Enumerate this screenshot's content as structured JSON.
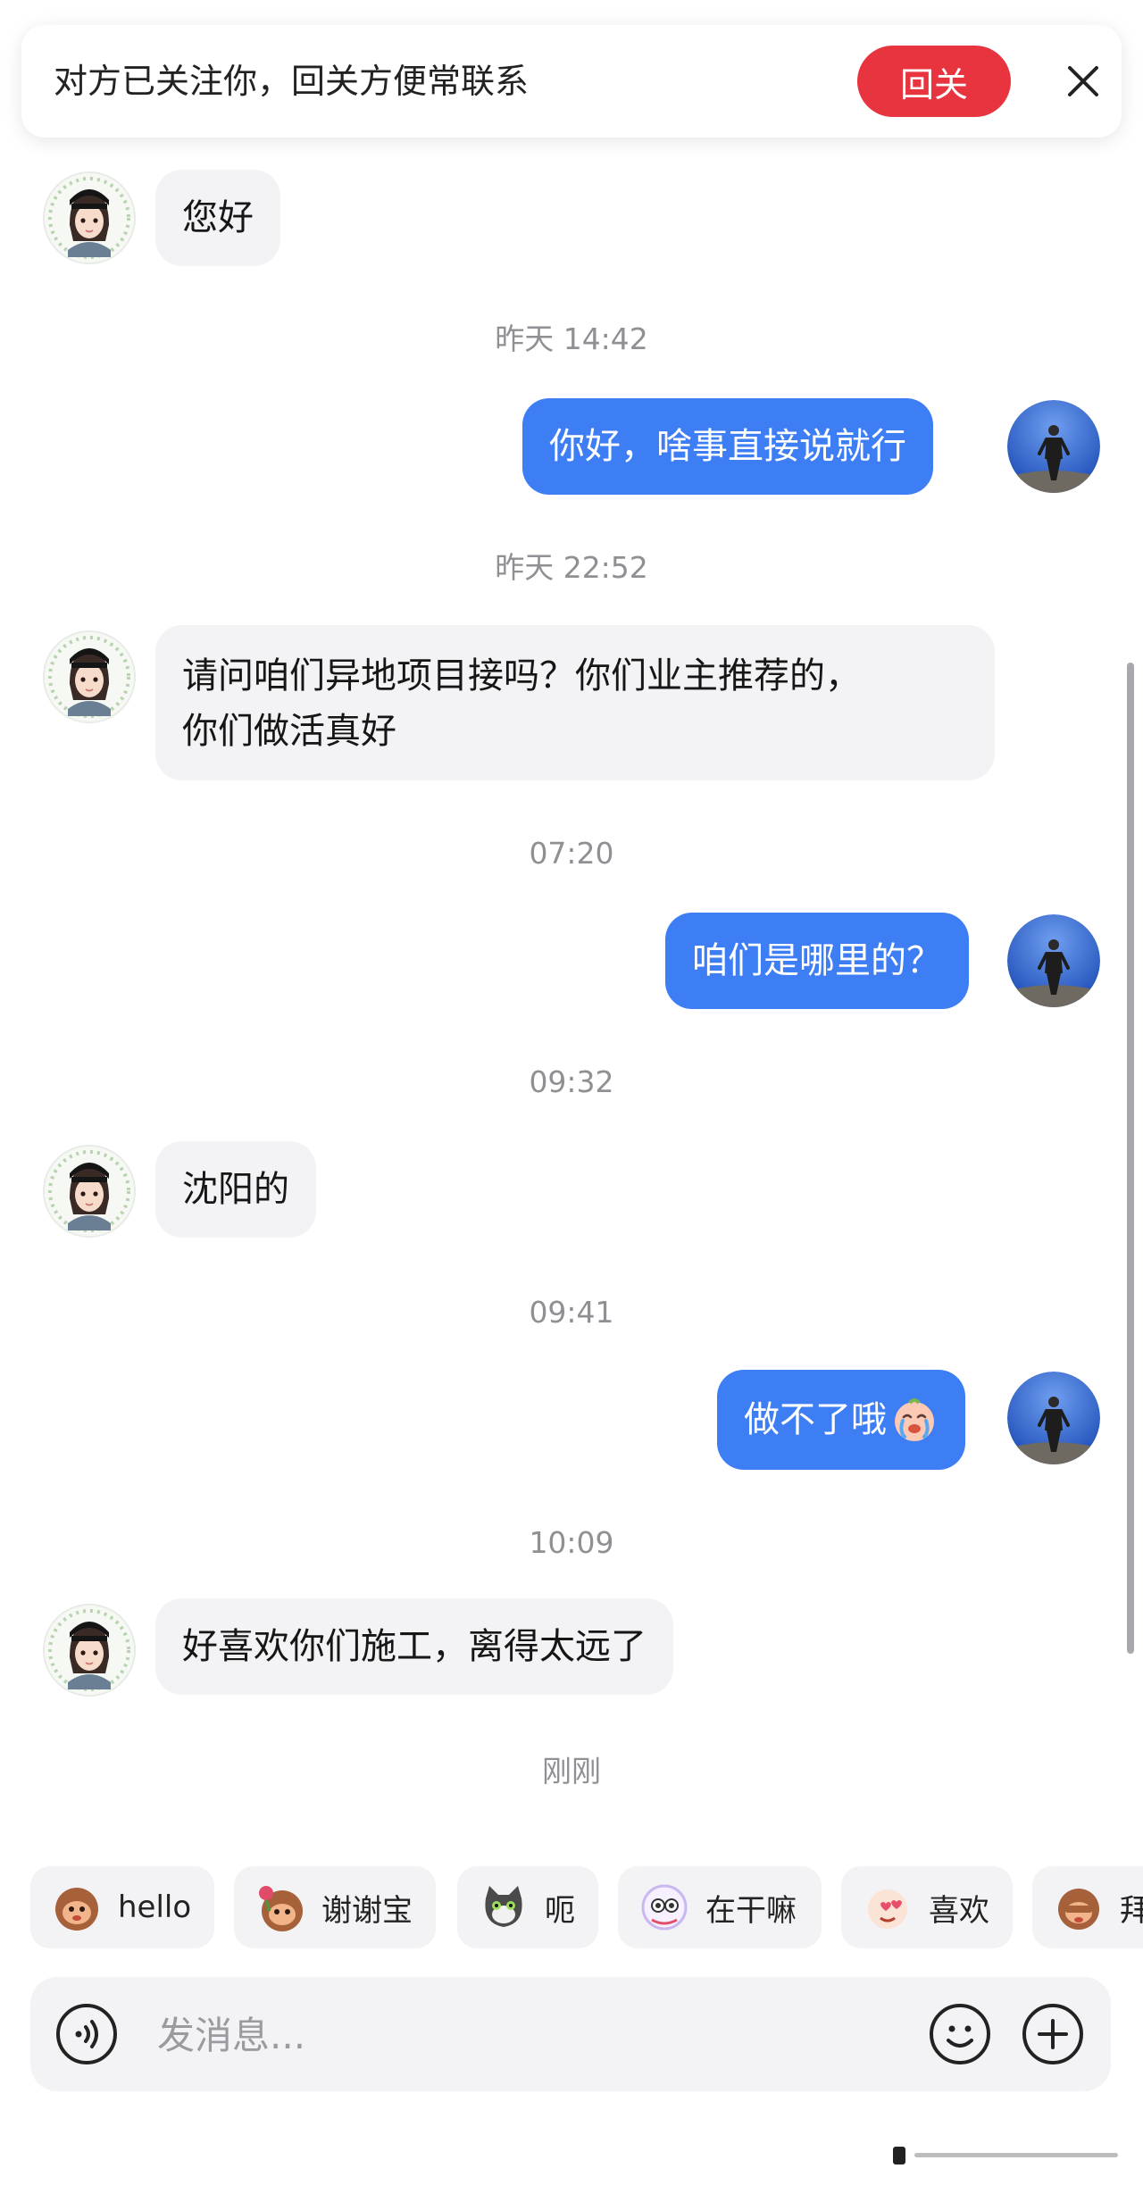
{
  "banner": {
    "text": "对方已关注你，回关方便常联系",
    "follow_back_label": "回关"
  },
  "messages": [
    {
      "side": "in",
      "text": "您好"
    },
    {
      "timestamp": "昨天 14:42"
    },
    {
      "side": "out",
      "text": "你好，啥事直接说就行"
    },
    {
      "timestamp": "昨天 22:52"
    },
    {
      "side": "in",
      "lines": [
        "请问咱们异地项目接吗？你们业主推荐的，",
        "你们做活真好"
      ]
    },
    {
      "timestamp": "07:20"
    },
    {
      "side": "out",
      "text": "咱们是哪里的？"
    },
    {
      "timestamp": "09:32"
    },
    {
      "side": "in",
      "text": "沈阳的"
    },
    {
      "timestamp": "09:41"
    },
    {
      "side": "out",
      "text": "做不了哦",
      "emoji": "crying-face-emoji"
    },
    {
      "timestamp": "10:09"
    },
    {
      "side": "in",
      "text": "好喜欢你们施工，离得太远了"
    },
    {
      "timestamp": "刚刚"
    }
  ],
  "stickers": [
    {
      "label": "hello",
      "icon": "monkey-hello-icon"
    },
    {
      "label": "谢谢宝",
      "icon": "monkey-flower-icon"
    },
    {
      "label": "呃",
      "icon": "cat-icon"
    },
    {
      "label": "在干嘛",
      "icon": "peek-face-icon"
    },
    {
      "label": "喜欢",
      "icon": "heart-face-icon"
    },
    {
      "label": "拜",
      "icon": "monkey-bye-icon"
    }
  ],
  "input": {
    "placeholder": "发消息..."
  },
  "colors": {
    "outgoing_bubble": "#3d7ef5",
    "incoming_bubble": "#f3f3f5",
    "follow_button": "#e8343f"
  }
}
